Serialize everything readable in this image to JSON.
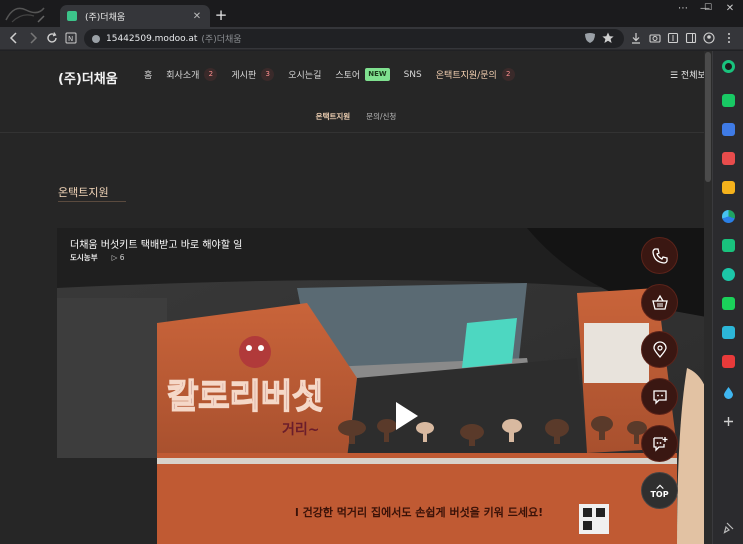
{
  "browser": {
    "tab_title": "(주)더채움",
    "tab_close": "✕",
    "new_tab": "+",
    "url_host": "15442509.modoo.at",
    "url_rest": "(주)더채움",
    "window_controls": [
      "⋯",
      "—",
      "☐",
      "✕"
    ]
  },
  "site": {
    "brand": "(주)더채움",
    "nav": [
      {
        "label": "홈",
        "badge": ""
      },
      {
        "label": "회사소개",
        "badge": "2"
      },
      {
        "label": "게시판",
        "badge": "3"
      },
      {
        "label": "오시는길",
        "badge": ""
      },
      {
        "label": "스토어",
        "badge": "NEW"
      },
      {
        "label": "SNS",
        "badge": ""
      },
      {
        "label": "온택트지원/문의",
        "badge": "2"
      }
    ],
    "full_menu": "☰ 전체보기",
    "subnav": [
      "온택트지원",
      "문의/신청"
    ],
    "section_title": "온택트지원"
  },
  "video": {
    "title": "더채움 버섯키트 택배받고 바로 해야할 일",
    "author": "도시농부",
    "views": "▷ 6"
  },
  "fab": {
    "top_label": "TOP"
  },
  "colors": {
    "accent": "#f3d6b9",
    "fab_bg": "#3a1712",
    "page_bg": "#262626"
  }
}
